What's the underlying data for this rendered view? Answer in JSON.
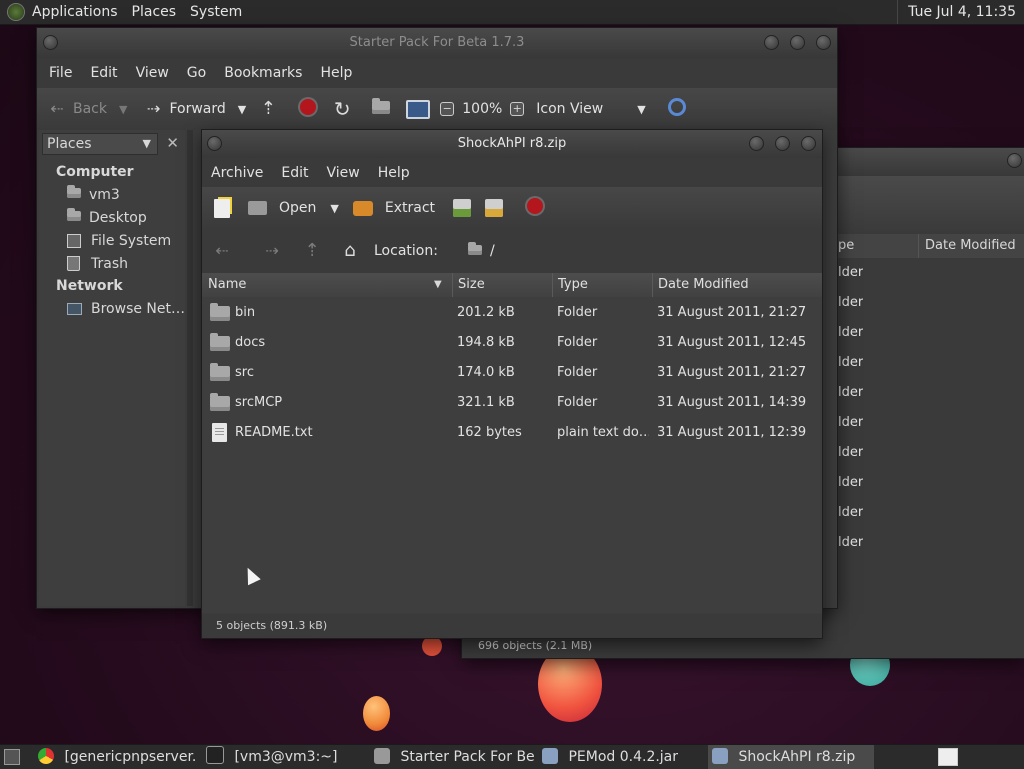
{
  "top_panel": {
    "menus": [
      "Applications",
      "Places",
      "System"
    ],
    "clock": "Tue Jul  4, 11:35"
  },
  "back_window": {
    "col_type_partial": "pe",
    "col_date": "Date Modified",
    "row_type_partial": "older",
    "status": "696 objects (2.1 MB)"
  },
  "starter_window": {
    "title": "Starter Pack For Beta 1.7.3",
    "menus": [
      "File",
      "Edit",
      "View",
      "Go",
      "Bookmarks",
      "Help"
    ],
    "toolbar": {
      "back": "Back",
      "forward": "Forward",
      "zoom": "100%",
      "view_mode": "Icon View"
    },
    "sidebar": {
      "header": "Places",
      "sections": [
        {
          "title": "Computer",
          "items": [
            "vm3",
            "Desktop",
            "File System",
            "Trash"
          ]
        },
        {
          "title": "Network",
          "items": [
            "Browse Net…"
          ]
        }
      ]
    }
  },
  "archive_window": {
    "title": "ShockAhPI r8.zip",
    "menus": [
      "Archive",
      "Edit",
      "View",
      "Help"
    ],
    "toolbar": {
      "open": "Open",
      "extract": "Extract"
    },
    "location_label": "Location:",
    "location_path": "/",
    "columns": [
      "Name",
      "Size",
      "Type",
      "Date Modified"
    ],
    "files": [
      {
        "name": "bin",
        "size": "201.2 kB",
        "type": "Folder",
        "date": "31 August 2011, 21:27",
        "icon": "folder-icon"
      },
      {
        "name": "docs",
        "size": "194.8 kB",
        "type": "Folder",
        "date": "31 August 2011, 12:45",
        "icon": "folder-icon"
      },
      {
        "name": "src",
        "size": "174.0 kB",
        "type": "Folder",
        "date": "31 August 2011, 21:27",
        "icon": "folder-icon"
      },
      {
        "name": "srcMCP",
        "size": "321.1 kB",
        "type": "Folder",
        "date": "31 August 2011, 14:39",
        "icon": "folder-icon"
      },
      {
        "name": "README.txt",
        "size": "162 bytes",
        "type": "plain text do…",
        "date": "31 August 2011, 12:39",
        "icon": "text-file-icon"
      }
    ],
    "status": "5 objects (891.3 kB)"
  },
  "taskbar": {
    "tasks": [
      "[genericpnpserver.d…",
      "[vm3@vm3:~]",
      "Starter Pack For Bet…",
      "PEMod 0.4.2.jar",
      "ShockAhPI r8.zip"
    ]
  },
  "colors": {
    "stop_red": "#b3161c",
    "panel": "#2b2b2b",
    "window": "#3c3c3c"
  }
}
